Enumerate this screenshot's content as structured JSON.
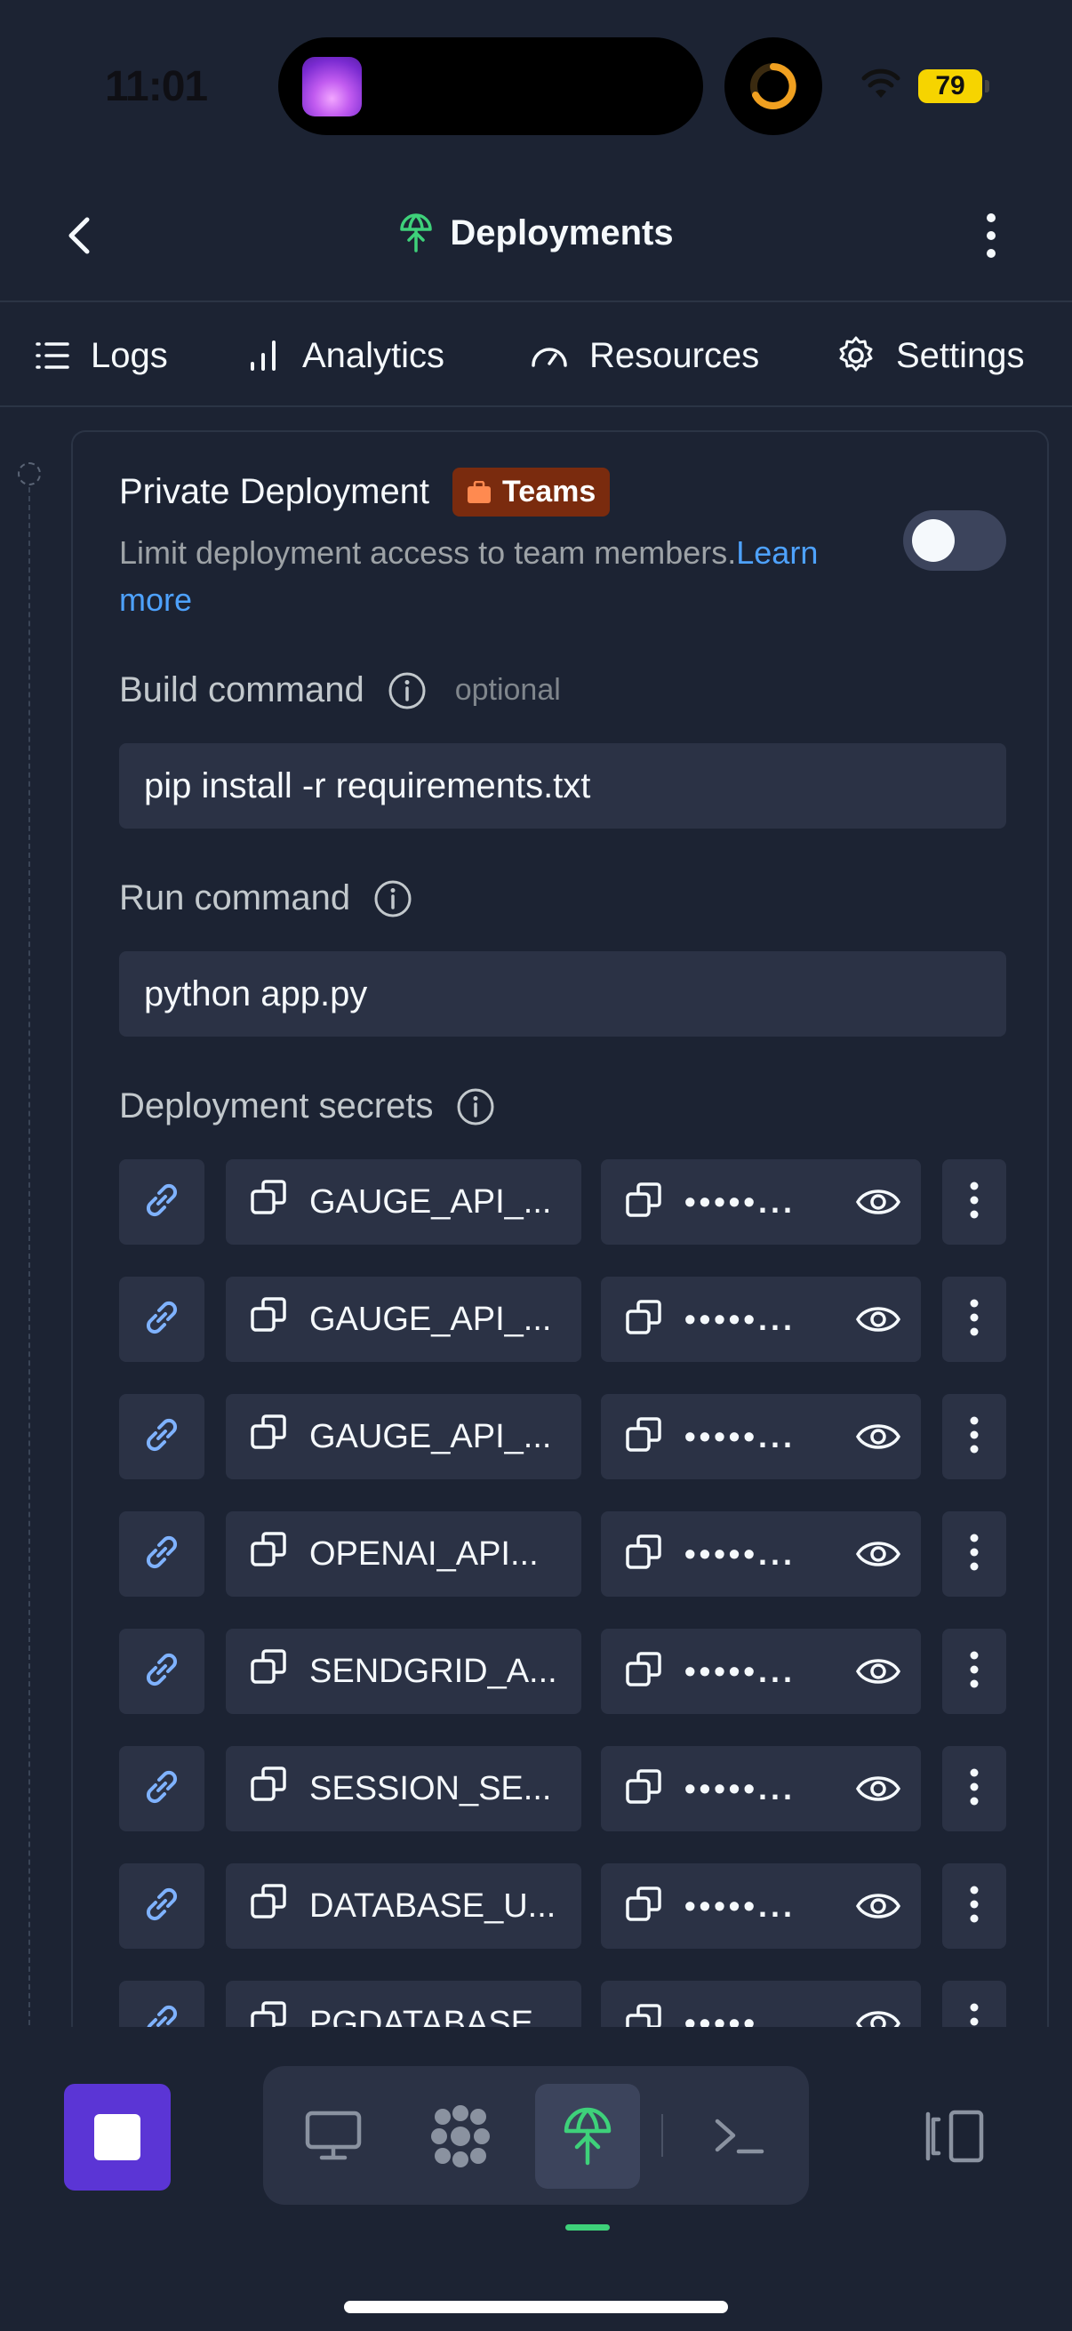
{
  "status_bar": {
    "time": "11:01",
    "battery": "79"
  },
  "header": {
    "title": "Deployments"
  },
  "tabs": [
    {
      "label": "Logs"
    },
    {
      "label": "Analytics"
    },
    {
      "label": "Resources"
    },
    {
      "label": "Settings"
    }
  ],
  "private": {
    "title": "Private Deployment",
    "badge": "Teams",
    "description": "Limit deployment access to team members.",
    "learn_more": "Learn more",
    "enabled": false
  },
  "build": {
    "label": "Build command",
    "optional": "optional",
    "value": "pip install -r requirements.txt"
  },
  "run": {
    "label": "Run command",
    "value": "python app.py"
  },
  "secrets": {
    "label": "Deployment secrets",
    "items": [
      {
        "key": "GAUGE_API_...",
        "value": "•••••..."
      },
      {
        "key": "GAUGE_API_...",
        "value": "•••••..."
      },
      {
        "key": "GAUGE_API_...",
        "value": "•••••..."
      },
      {
        "key": "OPENAI_API...",
        "value": "•••••..."
      },
      {
        "key": "SENDGRID_A...",
        "value": "•••••..."
      },
      {
        "key": "SESSION_SE...",
        "value": "•••••..."
      },
      {
        "key": "DATABASE_U...",
        "value": "•••••..."
      },
      {
        "key": "PGDATABASE",
        "value": "•••••..."
      }
    ]
  },
  "dock": [
    "monitor-icon",
    "workspace-icon",
    "deployments-icon",
    "shell-icon"
  ],
  "colors": {
    "accent_green": "#3ed17a",
    "badge_bg": "#7a2b0e",
    "link": "#4ea2ff",
    "stop_button": "#5b35d5"
  }
}
